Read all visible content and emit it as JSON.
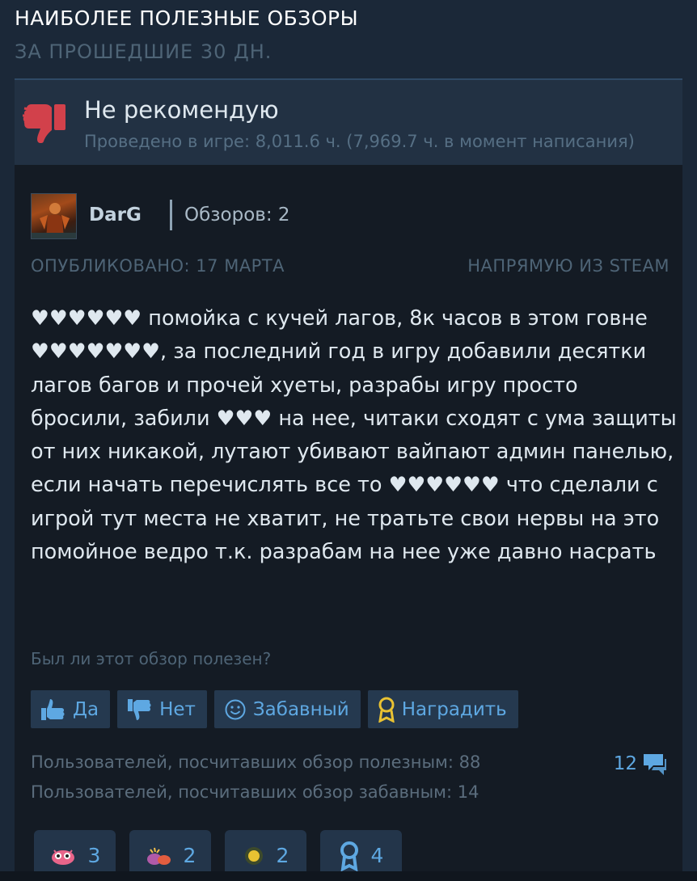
{
  "section": {
    "title": "НАИБОЛЕЕ ПОЛЕЗНЫЕ ОБЗОРЫ",
    "subtitle": "ЗА ПРОШЕДШИЕ 30 ДН."
  },
  "review": {
    "verdict": "Не рекомендую",
    "verdict_icon": "thumbs-down-icon",
    "playtime": "Проведено в игре: 8,011.6 ч. (7,969.7 ч. в момент написания)",
    "author": {
      "name": "DarG",
      "review_count": "Обзоров: 2"
    },
    "posted": "ОПУБЛИКОВАНО: 17 МАРТА",
    "source": "НАПРЯМУЮ ИЗ STEAM",
    "body": "♥♥♥♥♥♥ помойка с кучей лагов, 8к часов в этом говне ♥♥♥♥♥♥♥, за последний год в игру добавили десятки лагов багов и прочей хуеты, разрабы игру просто бросили, забили ♥♥♥ на нее, читаки сходят с ума защиты от них никакой, лутают убивают вайпают админ панелью, если начать перечислять все то ♥♥♥♥♥♥ что сделали с игрой тут места не хватит, не тратьте свои нервы на это помойное ведро т.к. разрабам на нее уже давно насрать",
    "helpful_question": "Был ли этот обзор полезен?",
    "buttons": {
      "yes": "Да",
      "no": "Нет",
      "funny": "Забавный",
      "award": "Наградить"
    },
    "stats": {
      "helpful": "Пользователей, посчитавших обзор полезным: 88",
      "funny": "Пользователей, посчитавших обзор забавным: 14"
    },
    "comment_count": "12",
    "awards": [
      {
        "icon": "creature-award-icon",
        "count": "3"
      },
      {
        "icon": "party-award-icon",
        "count": "2"
      },
      {
        "icon": "sun-award-icon",
        "count": "2"
      },
      {
        "icon": "medal-award-icon",
        "count": "4"
      }
    ]
  },
  "colors": {
    "accent": "#5ea8e2",
    "negative": "#d2414b",
    "background": "#1b2838"
  }
}
